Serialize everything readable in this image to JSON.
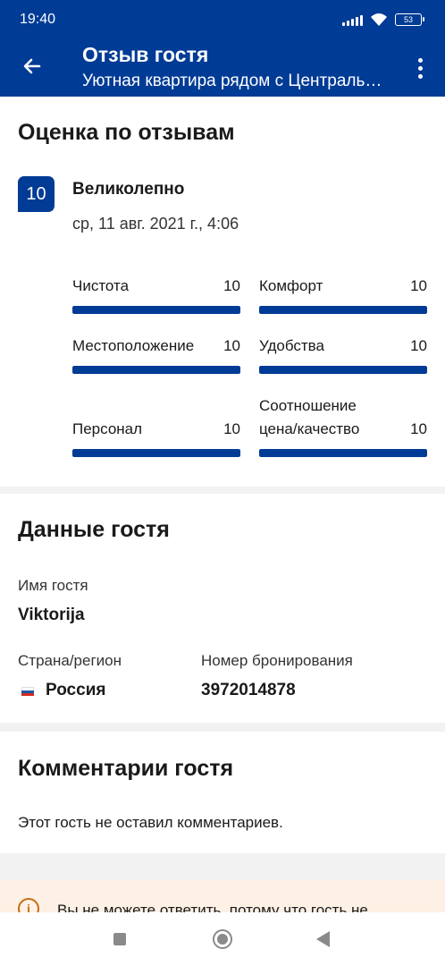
{
  "status_bar": {
    "time": "19:40",
    "battery": "53"
  },
  "app_bar": {
    "title": "Отзыв гостя",
    "subtitle": "Уютная квартира рядом с Центральным"
  },
  "rating_section": {
    "title": "Оценка по отзывам",
    "score": "10",
    "score_word": "Великолепно",
    "date": "ср, 11 авг. 2021 г., 4:06",
    "max_score": 10,
    "categories": [
      {
        "label": "Чистота",
        "value": "10"
      },
      {
        "label": "Комфорт",
        "value": "10"
      },
      {
        "label": "Местоположение",
        "value": "10"
      },
      {
        "label": "Удобства",
        "value": "10"
      },
      {
        "label": "Персонал",
        "value": "10"
      },
      {
        "label_line1": "Соотношение",
        "label_line2": "цена/качество",
        "value": "10"
      }
    ]
  },
  "guest_section": {
    "title": "Данные гостя",
    "name_label": "Имя гостя",
    "name": "Viktorija",
    "country_label": "Страна/регион",
    "country": "Россия",
    "booking_label": "Номер бронирования",
    "booking_number": "3972014878"
  },
  "comments_section": {
    "title": "Комментарии гостя",
    "text": "Этот гость не оставил комментариев."
  },
  "notice": {
    "icon": "i",
    "text": "Вы не можете ответить, потому что гость не"
  },
  "colors": {
    "brand": "#003b95",
    "bar_track": "#e6e6e6",
    "notice_bg": "#fdf0e4",
    "notice_accent": "#c46f15"
  }
}
